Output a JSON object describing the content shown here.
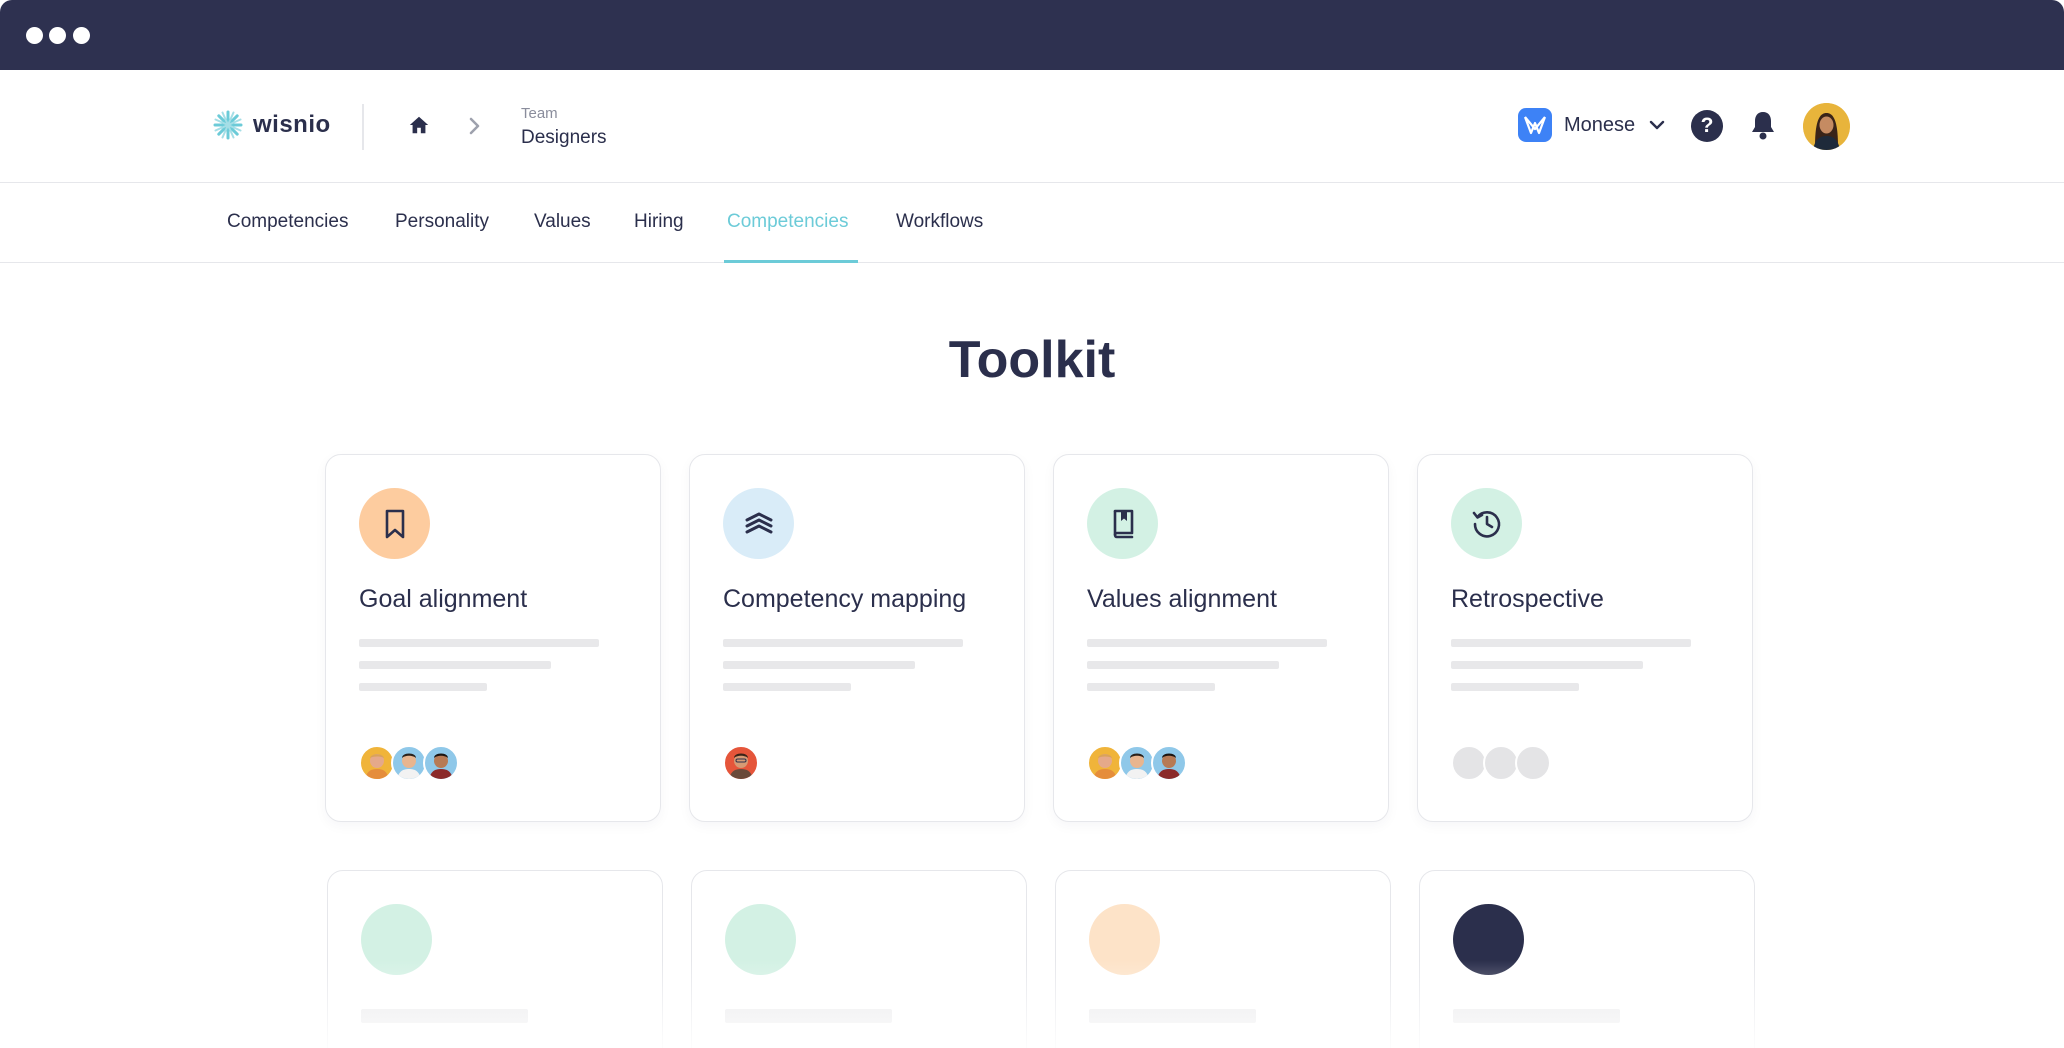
{
  "window": {
    "controls": [
      "window-dot",
      "window-dot",
      "window-dot"
    ]
  },
  "header": {
    "logo_text": "wisnio",
    "breadcrumb": {
      "label": "Team",
      "current": "Designers"
    },
    "org": {
      "name": "Monese"
    },
    "help_label": "?"
  },
  "nav": {
    "tabs": [
      {
        "label": "Competencies"
      },
      {
        "label": "Personality"
      },
      {
        "label": "Values"
      },
      {
        "label": "Hiring"
      },
      {
        "label": "Competencies",
        "active": true
      },
      {
        "label": "Workflows"
      }
    ]
  },
  "main": {
    "title": "Toolkit",
    "cards": [
      {
        "title": "Goal alignment",
        "icon": "bookmark-icon",
        "icon_bg": "#fdcc9f"
      },
      {
        "title": "Competency mapping",
        "icon": "layers-icon",
        "icon_bg": "#d9ecf8"
      },
      {
        "title": "Values alignment",
        "icon": "book-icon",
        "icon_bg": "#d3f1e4"
      },
      {
        "title": "Retrospective",
        "icon": "history-icon",
        "icon_bg": "#d3f1e4"
      }
    ],
    "placeholder_cards": [
      {
        "icon_bg": "#d3f1e4"
      },
      {
        "icon_bg": "#d3f1e4"
      },
      {
        "icon_bg": "#fde3c8"
      },
      {
        "icon_bg": "#2b2f4c"
      }
    ]
  },
  "colors": {
    "accent": "#6ccbd8",
    "navy": "#2e3150",
    "text": "#2b2f4c"
  }
}
